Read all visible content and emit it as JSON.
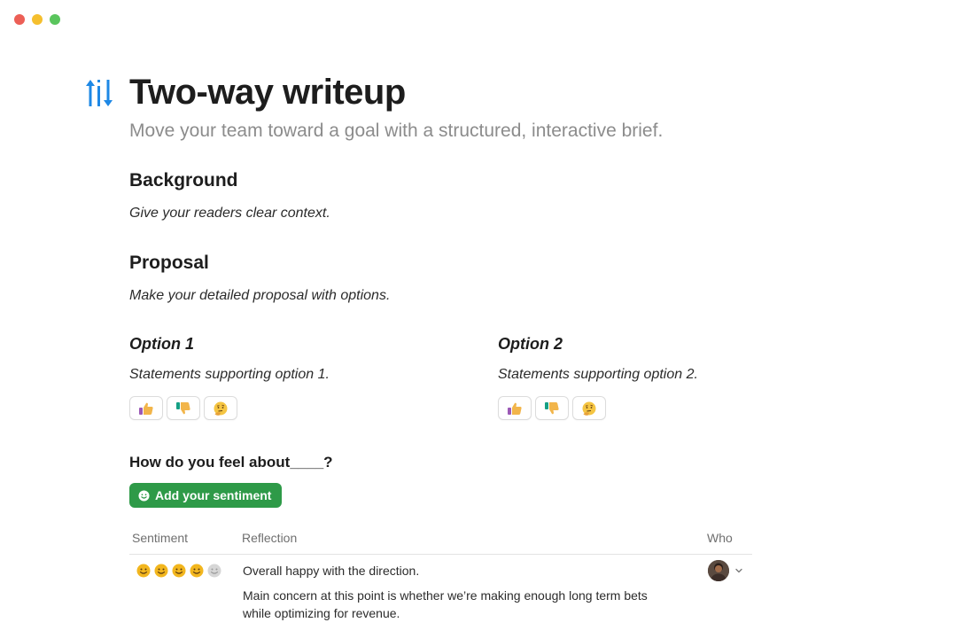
{
  "window": {
    "controls": [
      "close",
      "minimize",
      "zoom"
    ]
  },
  "page": {
    "icon": "up-down-arrows-icon",
    "title": "Two-way writeup",
    "subtitle": "Move your team toward a goal with a structured, interactive brief."
  },
  "background": {
    "heading": "Background",
    "text": "Give your readers clear context."
  },
  "proposal": {
    "heading": "Proposal",
    "text": "Make your detailed proposal with options.",
    "options": [
      {
        "title": "Option 1",
        "text": "Statements supporting option 1.",
        "reactions": [
          "thumbs-up-icon",
          "thumbs-down-icon",
          "thinking-face-icon"
        ]
      },
      {
        "title": "Option 2",
        "text": "Statements supporting option 2.",
        "reactions": [
          "thumbs-up-icon",
          "thumbs-down-icon",
          "thinking-face-icon"
        ]
      }
    ]
  },
  "sentiment": {
    "question": "How do you feel about____?",
    "button_label": "Add your sentiment",
    "button_color": "#2e9a48",
    "columns": [
      "Sentiment",
      "Reflection",
      "Who"
    ],
    "rows": [
      {
        "rating": 4,
        "rating_max": 5,
        "reflection_1": "Overall happy with the direction.",
        "reflection_2_line_1": "Main concern at this point is whether we’re making enough long term bets",
        "reflection_2_line_2": "while optimizing for revenue."
      }
    ]
  }
}
